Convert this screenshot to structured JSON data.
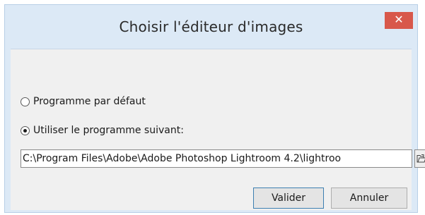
{
  "window": {
    "title": "Choisir l'éditeur d'images",
    "close_glyph": "✕"
  },
  "options": {
    "default_program_label": "Programme par défaut",
    "default_program_checked": false,
    "custom_program_label": "Utiliser le programme suivant:",
    "custom_program_checked": true
  },
  "path_field": {
    "value": "C:\\Program Files\\Adobe\\Adobe Photoshop Lightroom 4.2\\lightroo"
  },
  "browse_button": {
    "icon": "open-folder-icon"
  },
  "buttons": {
    "ok_label": "Valider",
    "cancel_label": "Annuler"
  },
  "colors": {
    "titlebar": "#dce9f6",
    "close": "#d8584b",
    "content": "#f0f0f0",
    "default_button_border": "#3c7fb1"
  }
}
